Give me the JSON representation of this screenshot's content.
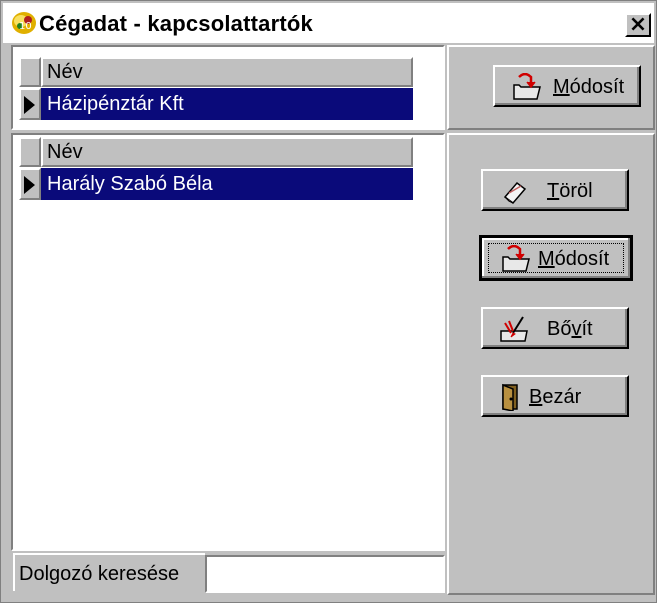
{
  "window": {
    "title": "Cégadat - kapcsolattartók",
    "close_glyph": "×",
    "app_icon": "app-icon"
  },
  "company_grid": {
    "column_header": "Név",
    "rows": [
      "Házipénztár Kft"
    ]
  },
  "contacts_grid": {
    "column_header": "Név",
    "rows": [
      "Harály Szabó Béla"
    ]
  },
  "search": {
    "label": "Dolgozó keresése",
    "value": ""
  },
  "buttons": {
    "company_modify": {
      "prefix": "",
      "hot": "M",
      "rest": "ódosít",
      "icon": "folder-edit-icon"
    },
    "delete": {
      "prefix": "",
      "hot": "T",
      "rest": "öröl",
      "icon": "eraser-icon"
    },
    "contact_modify": {
      "prefix": "",
      "hot": "M",
      "rest": "ódosít",
      "icon": "folder-edit-icon"
    },
    "expand": {
      "prefix": "Bő",
      "hot": "v",
      "rest": "ít",
      "icon": "pen-folder-icon"
    },
    "close": {
      "prefix": "",
      "hot": "B",
      "rest": "ezár",
      "icon": "door-icon"
    }
  },
  "colors": {
    "selection": "#0a0a7a",
    "face": "#c0c0c0"
  }
}
